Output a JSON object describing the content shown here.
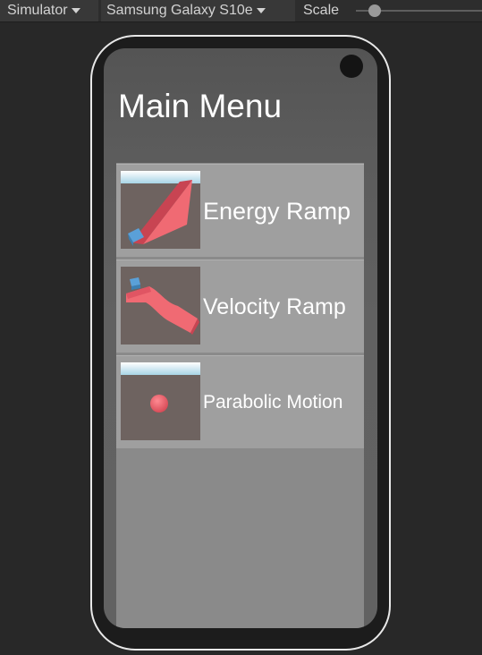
{
  "toolbar": {
    "mode_label": "Simulator",
    "device_label": "Samsung Galaxy S10e",
    "scale_label": "Scale",
    "scale_value": 0.1
  },
  "screen": {
    "title": "Main Menu",
    "menu_items": [
      {
        "label": "Energy Ramp",
        "thumbnail_icon": "energy-ramp-thumbnail"
      },
      {
        "label": "Velocity Ramp",
        "thumbnail_icon": "velocity-ramp-thumbnail"
      },
      {
        "label": "Parabolic Motion",
        "thumbnail_icon": "parabolic-motion-thumbnail"
      }
    ]
  },
  "colors": {
    "ramp": "#e65c68",
    "cube": "#4a90c8",
    "sky": "#cfe6f0"
  }
}
